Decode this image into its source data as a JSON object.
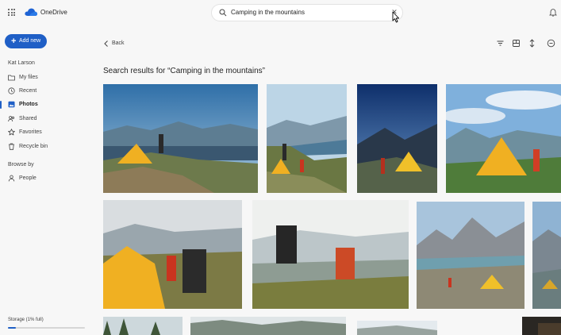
{
  "app": {
    "brand": "OneDrive"
  },
  "search": {
    "query": "Camping in the mountains"
  },
  "sidebar": {
    "add_new": "Add new",
    "user": "Kat Larson",
    "items": [
      {
        "label": "My files"
      },
      {
        "label": "Recent"
      },
      {
        "label": "Photos"
      },
      {
        "label": "Shared"
      },
      {
        "label": "Favorites"
      },
      {
        "label": "Recycle bin"
      }
    ],
    "browse_by": "Browse by",
    "people": "People",
    "storage": "Storage (1% full)",
    "storage_fraction": 0.1
  },
  "main": {
    "back": "Back",
    "results_title": "Search results for “Camping in the mountains”"
  },
  "icons": {
    "waffle": "app-launcher-icon",
    "logo": "onedrive-cloud-icon",
    "search": "search-icon",
    "clear": "close-icon",
    "bell": "bell-icon",
    "filter": "filter-icon",
    "view": "view-icon",
    "sort": "sort-icon",
    "more": "more-icon"
  },
  "colors": {
    "accent": "#1f5fc6",
    "background": "#f7f7f7"
  }
}
